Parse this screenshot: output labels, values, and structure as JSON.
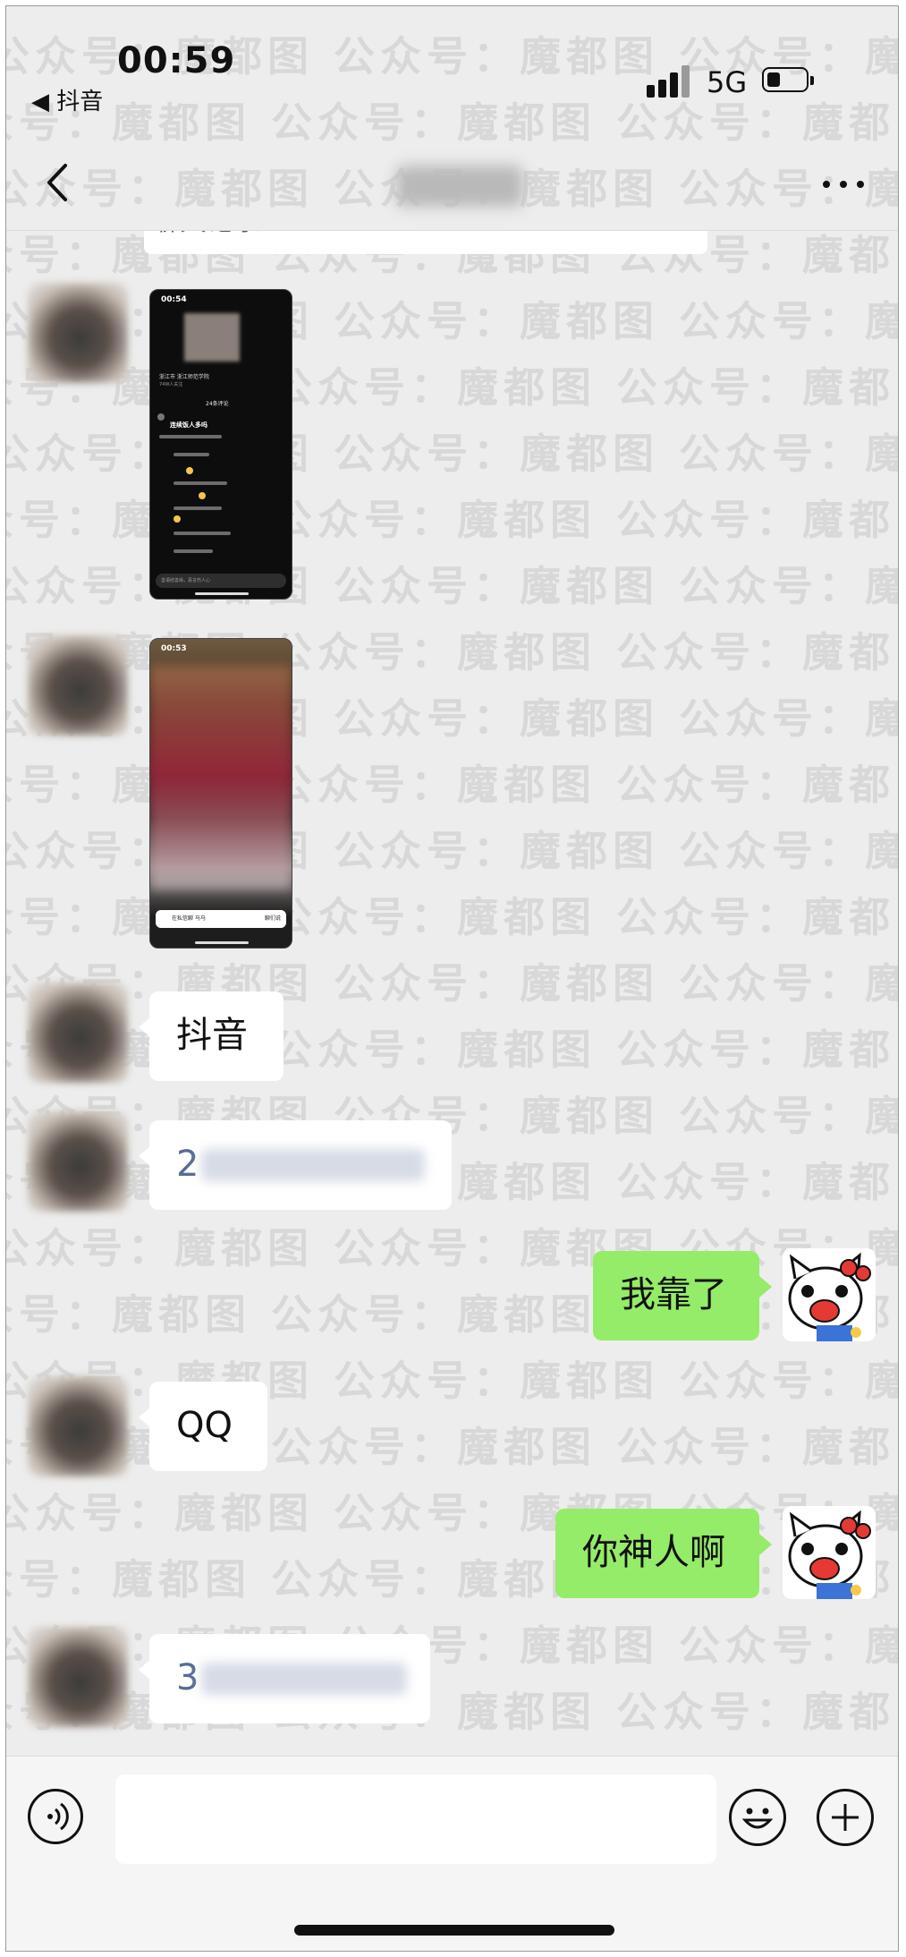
{
  "status_bar": {
    "time": "00:59",
    "back_app": "◀ 抖音",
    "network": "5G"
  },
  "nav": {
    "title": "聊天"
  },
  "chat": {
    "previous_message": "聊天记录",
    "messages": [
      {
        "side": "left",
        "type": "image",
        "description": "screenshot-comments"
      },
      {
        "side": "left",
        "type": "image",
        "description": "screenshot-live"
      },
      {
        "side": "left",
        "type": "text",
        "text": "抖音"
      },
      {
        "side": "left",
        "type": "text",
        "text": "2"
      },
      {
        "side": "right",
        "type": "text",
        "text": "我靠了"
      },
      {
        "side": "left",
        "type": "text",
        "text": "QQ"
      },
      {
        "side": "right",
        "type": "text",
        "text": "你神人啊"
      },
      {
        "side": "left",
        "type": "text",
        "text": "3"
      }
    ],
    "screenshot1": {
      "time": "00:54",
      "header": "浙江市 浙江师范学院",
      "subheader": "74W人关注",
      "comment_count": "24条评论",
      "comment_title": "连续饭人多吗",
      "input_placeholder": "善语结善缘，恶言伤人心"
    },
    "screenshot2": {
      "time": "00:53",
      "bottom_text": "在私信聊 马马",
      "bottom_action": "聊们说"
    }
  },
  "watermark_text": "公众号：魔都图",
  "colors": {
    "background": "#ededed",
    "bubble_me": "#95ec69",
    "bubble_other": "#ffffff",
    "number_text": "#576b95"
  },
  "icons": {
    "back": "chevron-left-icon",
    "more": "more-icon",
    "voice": "voice-icon",
    "emoji": "emoji-icon",
    "plus": "plus-icon"
  }
}
